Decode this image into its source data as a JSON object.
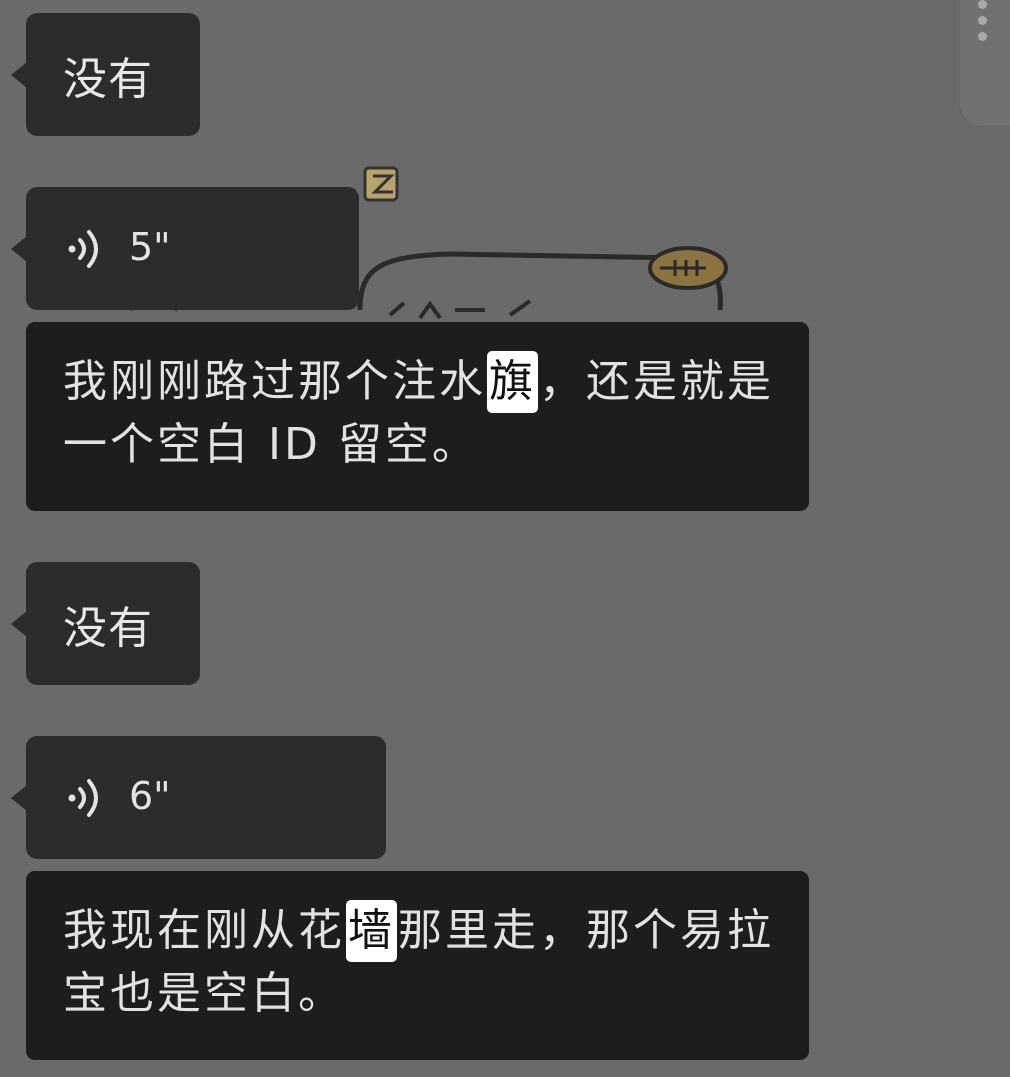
{
  "messages": [
    {
      "text": "没有"
    },
    {
      "duration": "5\""
    },
    {
      "transcript_before": "我刚刚路过那个注水",
      "transcript_highlight": "旗",
      "transcript_after": "，还是就是一个空白 ID 留空。"
    },
    {
      "text": "没有"
    },
    {
      "duration": "6\""
    },
    {
      "transcript_before": "我现在刚从花",
      "transcript_highlight": "墙",
      "transcript_after": "那里走，那个易拉宝也是空白。"
    }
  ],
  "icons": {
    "voice": "voice-playback-icon",
    "menu": "more-vertical-icon"
  },
  "colors": {
    "background": "#6a6a6a",
    "bubble": "#2c2c2c",
    "transcript": "#1d1d1d",
    "highlight": "#ffffff"
  }
}
